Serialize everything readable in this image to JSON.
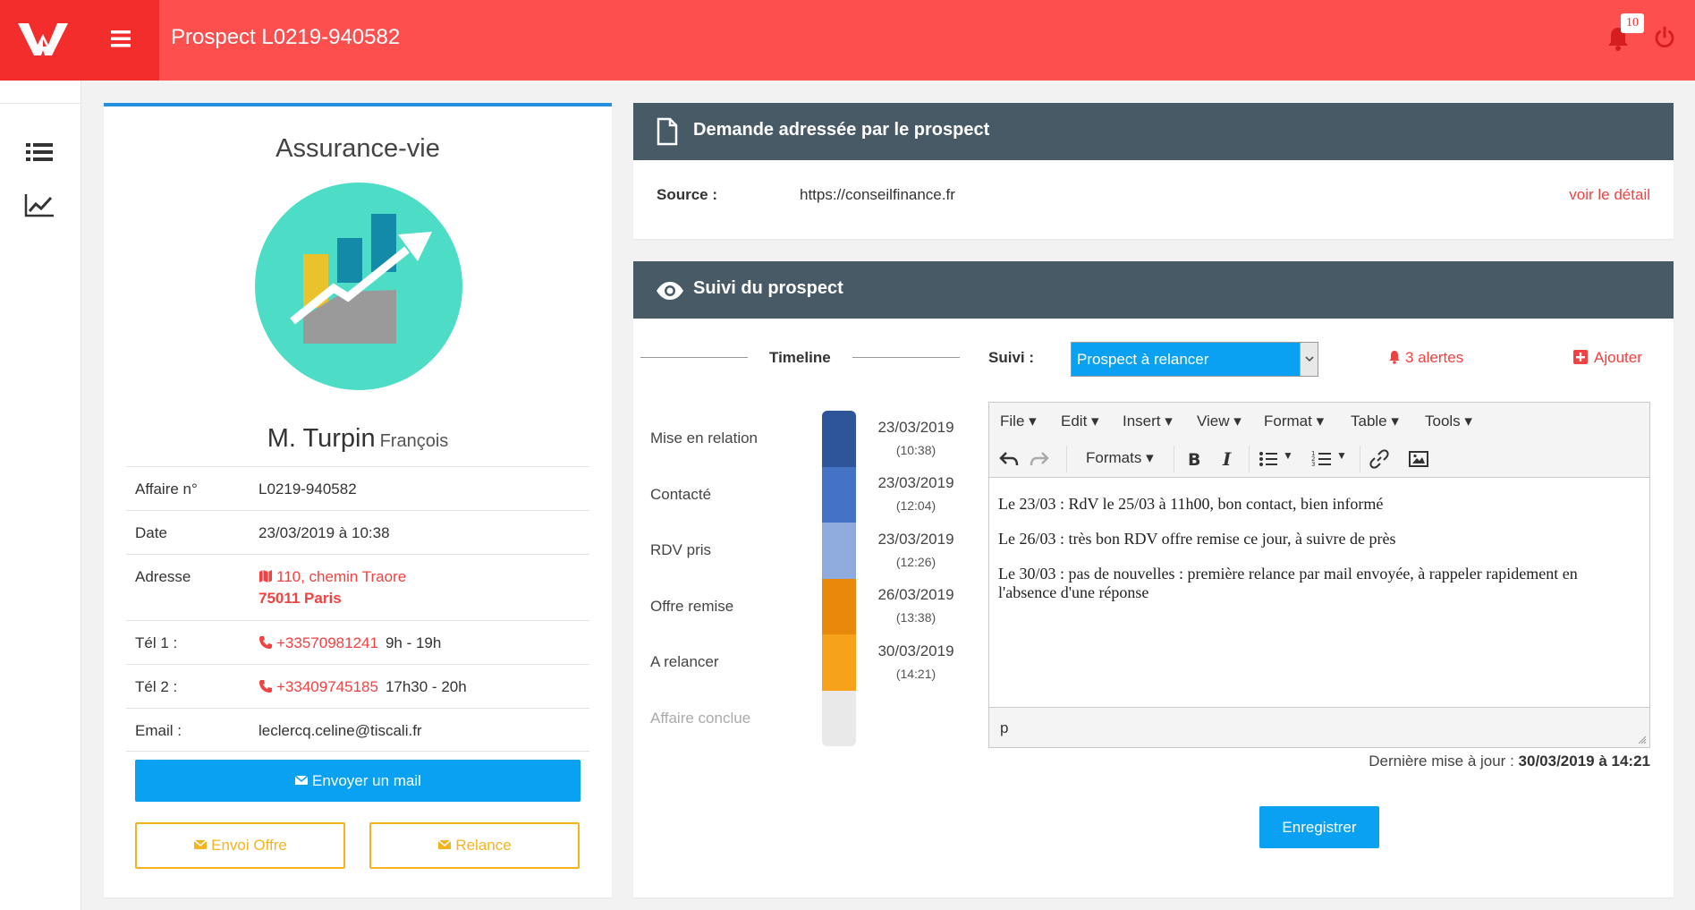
{
  "header": {
    "title": "Prospect L0219-940582",
    "notifications": "10"
  },
  "left": {
    "product": "Assurance-vie",
    "name": "M. Turpin",
    "firstname": "François",
    "rows": {
      "affaire_lbl": "Affaire n°",
      "affaire_val": "L0219-940582",
      "date_lbl": "Date",
      "date_val": "23/03/2019 à 10:38",
      "adresse_lbl": "Adresse",
      "adresse_line1": "110, chemin Traore",
      "adresse_line2": "75011 Paris",
      "tel1_lbl": "Tél 1 :",
      "tel1_val": "+33570981241",
      "tel1_hours": "9h - 19h",
      "tel2_lbl": "Tél 2 :",
      "tel2_val": "+33409745185",
      "tel2_hours": "17h30 - 20h",
      "email_lbl": "Email :",
      "email_val": "leclercq.celine@tiscali.fr"
    },
    "btn_mail": "Envoyer un mail",
    "btn_offre": "Envoi Offre",
    "btn_relance": "Relance"
  },
  "request": {
    "title": "Demande adressée par le prospect",
    "source_lbl": "Source :",
    "source_val": "https://conseilfinance.fr",
    "detail": "voir le détail"
  },
  "suivi": {
    "title": "Suivi du prospect",
    "timeline_lbl": "Timeline",
    "suivi_lbl": "Suivi :",
    "status": "Prospect à relancer",
    "alerts": "3 alertes",
    "add": "Ajouter",
    "steps": [
      {
        "label": "Mise en relation",
        "date": "23/03/2019",
        "time": "(10:38)",
        "color": "#2e5597"
      },
      {
        "label": "Contacté",
        "date": "23/03/2019",
        "time": "(12:04)",
        "color": "#4472c4"
      },
      {
        "label": "RDV pris",
        "date": "23/03/2019",
        "time": "(12:26)",
        "color": "#8faadc"
      },
      {
        "label": "Offre remise",
        "date": "26/03/2019",
        "time": "(13:38)",
        "color": "#e8890c"
      },
      {
        "label": "A relancer",
        "date": "30/03/2019",
        "time": "(14:21)",
        "color": "#f7a21b"
      },
      {
        "label": "Affaire conclue",
        "date": "",
        "time": "",
        "color": "#e9e9e9"
      }
    ],
    "editor": {
      "menu": [
        "File",
        "Edit",
        "Insert",
        "View",
        "Format",
        "Table",
        "Tools"
      ],
      "formats": "Formats",
      "lines": [
        "Le 23/03 : RdV le 25/03 à 11h00, bon contact, bien informé",
        "Le 26/03 : très bon RDV offre remise ce jour, à suivre de près",
        "Le 30/03 : pas de nouvelles : première relance par mail envoyée, à rappeler rapidement en l'absence d'une réponse"
      ],
      "path": "p"
    },
    "updated_lbl": "Dernière mise à jour :",
    "updated_val": "30/03/2019 à 14:21",
    "save": "Enregistrer"
  }
}
